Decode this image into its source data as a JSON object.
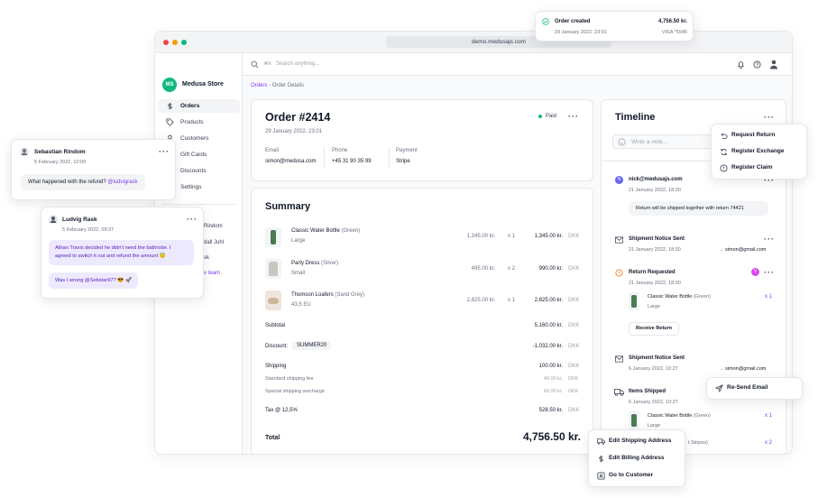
{
  "browser": {
    "url": "demo.medusajs.com"
  },
  "toast": {
    "title": "Order created",
    "amount": "4,756.50 kr.",
    "date": "29 January 2022, 23:01",
    "payment": "VISA *5545"
  },
  "sidebar": {
    "store_initials": "MS",
    "store_name": "Medusa Store",
    "items": [
      {
        "label": "Orders",
        "icon": "dollar-icon"
      },
      {
        "label": "Products",
        "icon": "tag-icon"
      },
      {
        "label": "Customers",
        "icon": "user-icon"
      },
      {
        "label": "Gift Cards",
        "icon": "gift-icon"
      },
      {
        "label": "Discounts",
        "icon": "percent-icon"
      },
      {
        "label": "Settings",
        "icon": "gear-icon"
      }
    ],
    "team": [
      "Rindom",
      "dall Juhl",
      "sk",
      "v team"
    ]
  },
  "topbar": {
    "search_placeholder": "Search anything...",
    "shortcut": "⌘K"
  },
  "breadcrumb": {
    "root": "Orders",
    "current": "Order Details"
  },
  "order": {
    "title": "Order #2414",
    "date": "29 January 2022, 23:01",
    "status": "Paid",
    "email_label": "Email",
    "email": "simon@medusa.com",
    "phone_label": "Phone",
    "phone": "+45 31 90 35 99",
    "payment_label": "Payment",
    "payment": "Stripe"
  },
  "summary": {
    "title": "Summary",
    "items": [
      {
        "name": "Classic Water Bottle",
        "variant": "(Green)",
        "sub": "Large",
        "price": "1,345.00 kr.",
        "qty": "x 1",
        "total": "1,345.00 kr.",
        "currency": "DKK"
      },
      {
        "name": "Party Dress",
        "variant": "(Silver)",
        "sub": "Small",
        "price": "495.00 kr.",
        "qty": "x 2",
        "total": "990.00 kr.",
        "currency": "DKK"
      },
      {
        "name": "Thomson Loafers",
        "variant": "(Sand Grey)",
        "sub": "43,5 EU",
        "price": "2,825.00 kr.",
        "qty": "x 1",
        "total": "2,825.00 kr.",
        "currency": "DKK"
      }
    ],
    "subtotal_label": "Subtotal",
    "subtotal": "5,160.00 kr.",
    "discount_label": "Discount:",
    "discount_code": "SUMMER20",
    "discount": "-1,032.00 kr.",
    "shipping_label": "Shipping",
    "shipping": "100.00 kr.",
    "standard_label": "Standard shipping fee",
    "standard": "40.00 kr.",
    "special_label": "Special shipping surcharge",
    "special": "60.00 kr.",
    "tax_label": "Tax @ 12,5%",
    "tax": "528.50 kr.",
    "total_label": "Total",
    "total": "4,756.50 kr.",
    "currency": "DKK"
  },
  "timeline": {
    "title": "Timeline",
    "note_placeholder": "Write a note...",
    "events": [
      {
        "title": "nick@medusajs.com",
        "date": "21 January 2022, 18:30",
        "message": "Return will be shipped together with return 74421"
      },
      {
        "title": "Shipment Notice Sent",
        "date": "21 January 2022, 18:30",
        "to": "simon@gmail.com"
      },
      {
        "title": "Return Requested",
        "date": "21 January 2022, 18:30",
        "item": "Classic Water Bottle",
        "variant": "(Green)",
        "sub": "Large",
        "qty": "x 1",
        "button": "Receive Return"
      },
      {
        "title": "Shipment Notice Sent",
        "date": "6 January 2022, 10:27",
        "to": "simon@gmail.com"
      },
      {
        "title": "Items Shipped",
        "date": "6 January 2022, 10:27",
        "item": "Classic Water Bottle",
        "variant": "(Green)",
        "sub": "Large",
        "qty": "x 1",
        "item2_variant": "t Stripes)",
        "qty2": "x 2"
      }
    ]
  },
  "return_menu": {
    "items": [
      "Request Return",
      "Register Exchange",
      "Register Claim"
    ]
  },
  "resend_menu": {
    "label": "Re-Send Email"
  },
  "customer_menu": {
    "items": [
      "Edit Shipping Address",
      "Edit Billing Address",
      "Go to Customer"
    ]
  },
  "comments": [
    {
      "author": "Sebastian Rindom",
      "date": "5 February 2022, 10:09",
      "text": "What happened with the refund?",
      "mention": "@ludvigrask"
    },
    {
      "author": "Ludvig Rask",
      "date": "5 February 2022, 09:37",
      "text": "Athan Travis decided he didn't need the bathrobe. I agreed to switch it out and refund the amount 😇",
      "text2": "Was I wrong @Sebstar97? 😎 🚀"
    }
  ],
  "colors": {
    "accent": "#7c3aed",
    "success": "#10b981",
    "danger": "#ef4444",
    "warning": "#f97316"
  }
}
